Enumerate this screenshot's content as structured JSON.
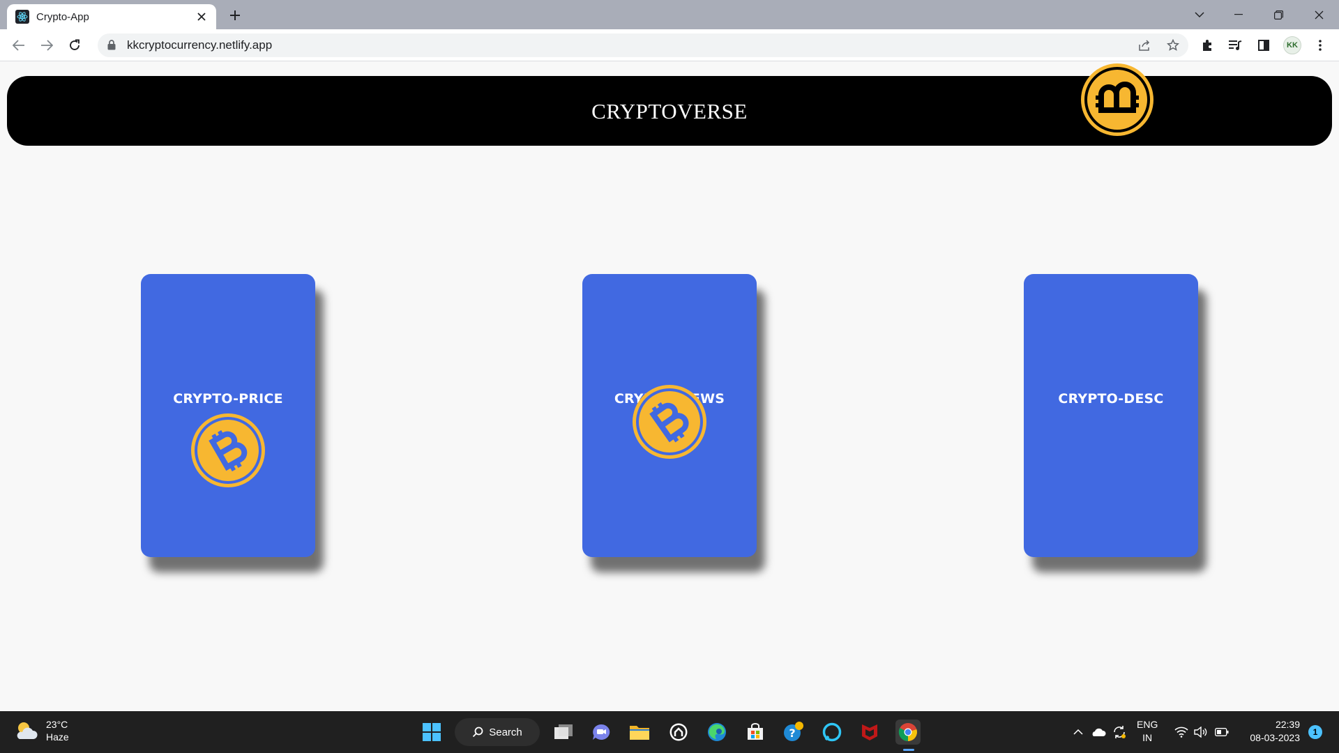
{
  "browser": {
    "tab_title": "Crypto-App",
    "url": "kkcryptocurrency.netlify.app",
    "profile_initials": "KK"
  },
  "header": {
    "brand": "CRYPTOVERSE"
  },
  "cards": [
    {
      "label": "CRYPTO-PRICE"
    },
    {
      "label": "CRYPTO-NEWS"
    },
    {
      "label": "CRYPTO-DESC"
    }
  ],
  "colors": {
    "card_bg": "#4169e1",
    "coin": "#f7b731",
    "header_bg": "#000000"
  },
  "taskbar": {
    "weather_temp": "23°C",
    "weather_desc": "Haze",
    "search_label": "Search",
    "lang_line1": "ENG",
    "lang_line2": "IN",
    "time": "22:39",
    "date": "08-03-2023",
    "notification_count": "1"
  }
}
